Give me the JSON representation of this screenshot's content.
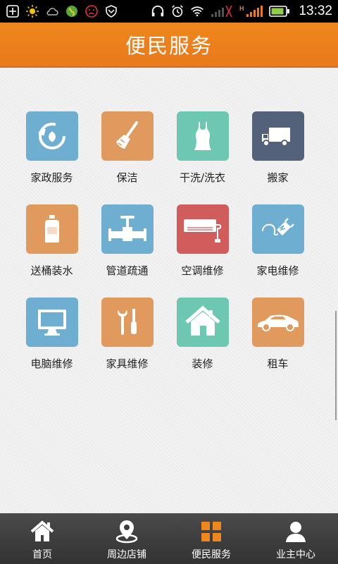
{
  "status_bar": {
    "time": "13:32"
  },
  "header": {
    "title": "便民服务"
  },
  "services": [
    {
      "label": "家政服务",
      "icon": "recycle-leaf-icon",
      "color": "#6eaed0"
    },
    {
      "label": "保洁",
      "icon": "broom-icon",
      "color": "#e09a5e"
    },
    {
      "label": "干洗/洗衣",
      "icon": "dress-icon",
      "color": "#6ec7b0"
    },
    {
      "label": "搬家",
      "icon": "truck-icon",
      "color": "#53617b"
    },
    {
      "label": "送桶装水",
      "icon": "water-bottle-icon",
      "color": "#e09a5e"
    },
    {
      "label": "管道疏通",
      "icon": "pipe-valve-icon",
      "color": "#6eaed0"
    },
    {
      "label": "空调维修",
      "icon": "air-conditioner-icon",
      "color": "#d05c5c"
    },
    {
      "label": "家电维修",
      "icon": "plug-icon",
      "color": "#6eaed0"
    },
    {
      "label": "电脑维修",
      "icon": "monitor-icon",
      "color": "#6eaed0"
    },
    {
      "label": "家具维修",
      "icon": "tools-icon",
      "color": "#e09a5e"
    },
    {
      "label": "装修",
      "icon": "house-icon",
      "color": "#6ec7b0"
    },
    {
      "label": "租车",
      "icon": "car-icon",
      "color": "#e09a5e"
    }
  ],
  "tabbar": {
    "tabs": [
      {
        "label": "首页",
        "icon": "home-icon",
        "active": false
      },
      {
        "label": "周边店铺",
        "icon": "location-pin-icon",
        "active": false
      },
      {
        "label": "便民服务",
        "icon": "grid-icon",
        "active": true
      },
      {
        "label": "业主中心",
        "icon": "person-icon",
        "active": false
      }
    ]
  },
  "colors": {
    "accent": "#f0871e",
    "active_tab": "#f0871e"
  }
}
